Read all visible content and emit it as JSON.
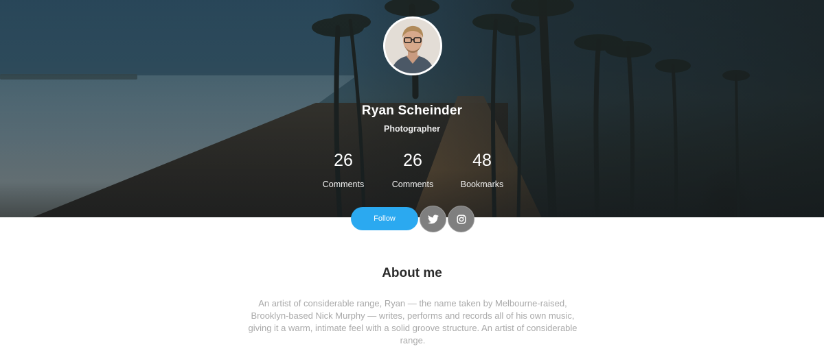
{
  "profile": {
    "name": "Ryan Scheinder",
    "title": "Photographer"
  },
  "stats": [
    {
      "value": "26",
      "label": "Comments"
    },
    {
      "value": "26",
      "label": "Comments"
    },
    {
      "value": "48",
      "label": "Bookmarks"
    }
  ],
  "actions": {
    "follow_label": "Follow",
    "social": [
      {
        "icon": "twitter-icon"
      },
      {
        "icon": "instagram-icon"
      }
    ]
  },
  "about": {
    "heading": "About me",
    "text": "An artist of considerable range, Ryan — the name taken by Melbourne-raised, Brooklyn-based Nick Murphy — writes, performs and records all of his own music, giving it a warm, intimate feel with a solid groove structure. An artist of considerable range."
  },
  "colors": {
    "accent": "#2ba9f0",
    "social_button": "#7f7f7f",
    "heading": "#2b2b2b",
    "body_text": "#a9a9a9"
  }
}
